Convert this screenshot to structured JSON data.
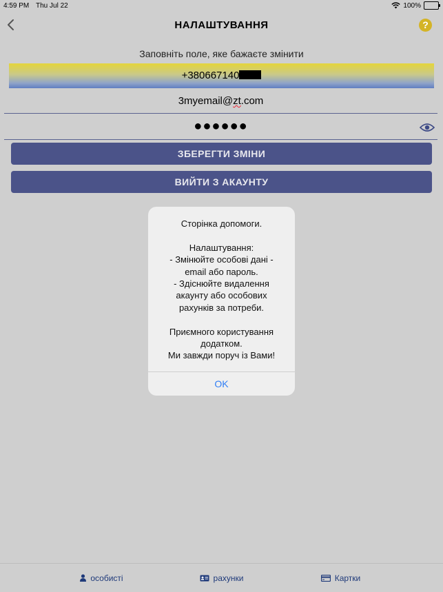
{
  "status_bar": {
    "time": "4:59 PM",
    "date": "Thu Jul 22",
    "battery": "100%"
  },
  "nav": {
    "title": "НАЛАШТУВАННЯ",
    "help_icon": "question-mark-icon",
    "back_icon": "chevron-left-icon"
  },
  "form": {
    "hint": "Заповніть поле, яке бажаєте змінити",
    "phone_value": "+380667140",
    "email_prefix": "3myemail@",
    "email_spell": "zt",
    "email_suffix": ".com",
    "password_value": "●●●●●●"
  },
  "buttons": {
    "save": "ЗБЕРЕГТИ ЗМІНИ",
    "logout": "ВИЙТИ З АКАУНТУ"
  },
  "alert": {
    "lines": [
      "Сторінка допомоги.",
      "",
      "Налаштування:",
      "- Змінюйте особові дані -",
      "email або пароль.",
      "- Здіснюйте видалення",
      "акаунту або особових",
      "рахунків за потреби.",
      "",
      "Приємного користування",
      "додатком.",
      "Ми завжди поруч із Вами!"
    ],
    "ok_label": "OK"
  },
  "tabs": [
    {
      "label": "особисті",
      "icon": "person-icon"
    },
    {
      "label": "рахунки",
      "icon": "id-card-icon"
    },
    {
      "label": "Картки",
      "icon": "credit-card-icon"
    }
  ],
  "colors": {
    "accent": "#4b5389",
    "help": "#d4b426",
    "link": "#2f7ef5"
  }
}
